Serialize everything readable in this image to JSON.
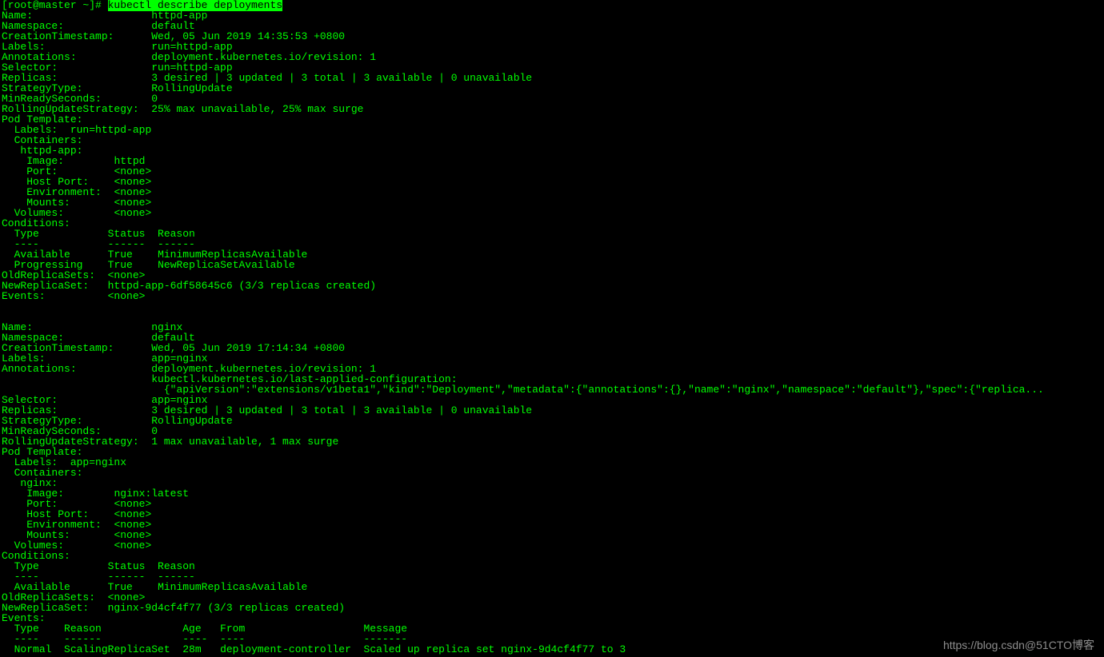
{
  "prompt": {
    "prefix": "[root@master ~]# ",
    "cmd": "kubectl describe deployments"
  },
  "dep1": {
    "name": "httpd-app",
    "namespace": "default",
    "creation": "Wed, 05 Jun 2019 14:35:53 +0800",
    "labels": "run=httpd-app",
    "annotations": "deployment.kubernetes.io/revision: 1",
    "selector": "run=httpd-app",
    "replicas": "3 desired | 3 updated | 3 total | 3 available | 0 unavailable",
    "strategy": "RollingUpdate",
    "minReady": "0",
    "rollingUpdate": "25% max unavailable, 25% max surge",
    "podLabels": "run=httpd-app",
    "containerName": "httpd-app:",
    "image": "httpd",
    "port": "<none>",
    "hostPort": "<none>",
    "environment": "<none>",
    "mounts": "<none>",
    "volumes": "<none>",
    "cond1Type": "Available",
    "cond1Status": "True",
    "cond1Reason": "MinimumReplicasAvailable",
    "cond2Type": "Progressing",
    "cond2Status": "True",
    "cond2Reason": "NewReplicaSetAvailable",
    "oldReplicaSets": "<none>",
    "newReplicaSet": "httpd-app-6df58645c6 (3/3 replicas created)",
    "events": "<none>"
  },
  "dep2": {
    "name": "nginx",
    "namespace": "default",
    "creation": "Wed, 05 Jun 2019 17:14:34 +0800",
    "labels": "app=nginx",
    "annotationsLine1": "deployment.kubernetes.io/revision: 1",
    "annotationsLine2": "kubectl.kubernetes.io/last-applied-configuration:",
    "annotationsJson": "{\"apiVersion\":\"extensions/v1beta1\",\"kind\":\"Deployment\",\"metadata\":{\"annotations\":{},\"name\":\"nginx\",\"namespace\":\"default\"},\"spec\":{\"replica...",
    "selector": "app=nginx",
    "replicas": "3 desired | 3 updated | 3 total | 3 available | 0 unavailable",
    "strategy": "RollingUpdate",
    "minReady": "0",
    "rollingUpdate": "1 max unavailable, 1 max surge",
    "podLabels": "app=nginx",
    "containerName": "nginx:",
    "image": "nginx:latest",
    "port": "<none>",
    "hostPort": "<none>",
    "environment": "<none>",
    "mounts": "<none>",
    "volumes": "<none>",
    "cond1Type": "Available",
    "cond1Status": "True",
    "cond1Reason": "MinimumReplicasAvailable",
    "oldReplicaSets": "<none>",
    "newReplicaSet": "nginx-9d4cf4f77 (3/3 replicas created)",
    "evt1Type": "Normal",
    "evt1Reason": "ScalingReplicaSet",
    "evt1Age": "28m",
    "evt1From": "deployment-controller",
    "evt1Msg": "Scaled up replica set nginx-9d4cf4f77 to 3"
  },
  "watermark": {
    "text": "https://blog.csdn@51CTO博客"
  }
}
